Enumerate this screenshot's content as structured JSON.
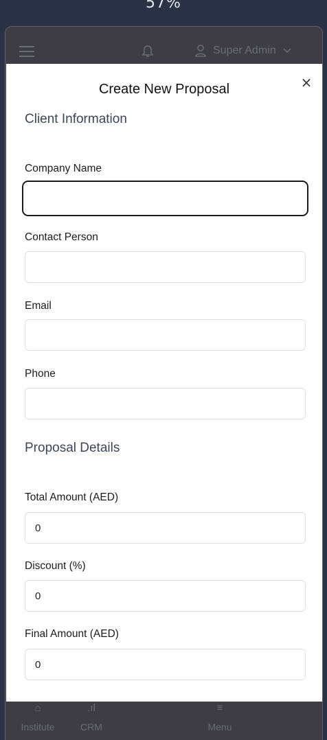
{
  "status_bar": {
    "percent": "57%"
  },
  "app_header": {
    "user_name": "Super Admin"
  },
  "modal": {
    "title": "Create New Proposal",
    "close_label": "×",
    "client_section": {
      "heading": "Client Information",
      "fields": {
        "company_name": {
          "label": "Company Name",
          "value": ""
        },
        "contact_person": {
          "label": "Contact Person",
          "value": ""
        },
        "email": {
          "label": "Email",
          "value": ""
        },
        "phone": {
          "label": "Phone",
          "value": ""
        }
      }
    },
    "proposal_section": {
      "heading": "Proposal Details",
      "fields": {
        "total_amount": {
          "label": "Total Amount (AED)",
          "value": "0"
        },
        "discount": {
          "label": "Discount (%)",
          "value": "0"
        },
        "final_amount": {
          "label": "Final Amount (AED)",
          "value": "0"
        }
      }
    }
  },
  "bottom_nav": {
    "items": [
      {
        "label": "Institute",
        "icon": "home-icon"
      },
      {
        "label": "CRM",
        "icon": "bar-chart-icon"
      },
      {
        "label": "Menu",
        "icon": "menu-icon"
      }
    ]
  }
}
